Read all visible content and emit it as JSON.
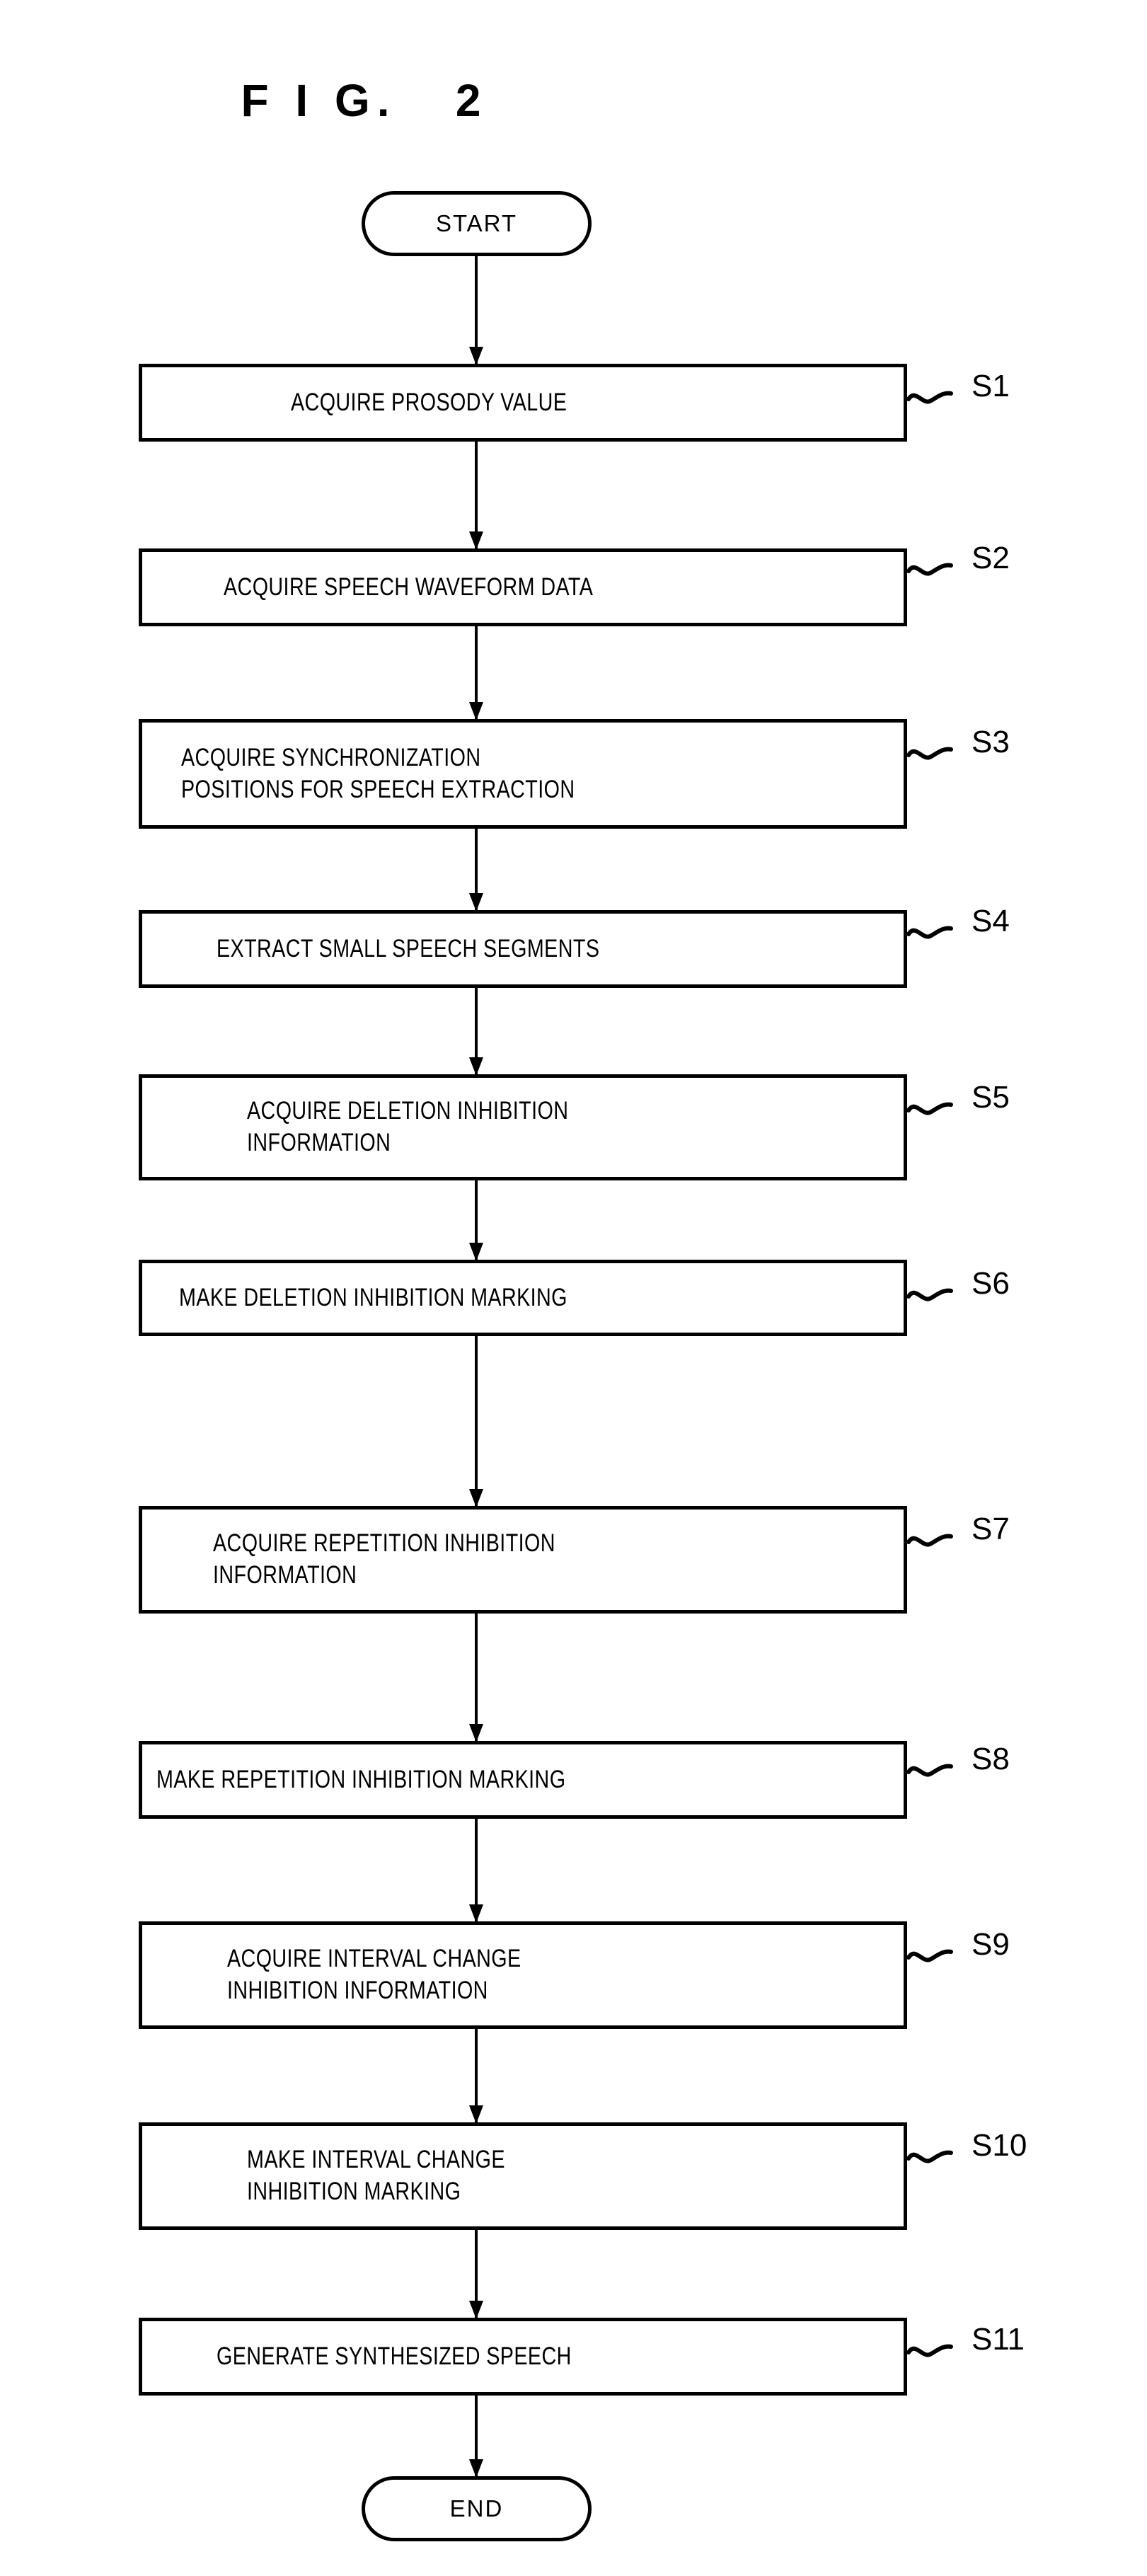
{
  "figure": {
    "title": "F I G.   2"
  },
  "flow": {
    "start_label": "START",
    "end_label": "END",
    "steps": [
      {
        "id": "S1",
        "label": "S1",
        "lines": [
          "ACQUIRE PROSODY VALUE"
        ]
      },
      {
        "id": "S2",
        "label": "S2",
        "lines": [
          "ACQUIRE SPEECH WAVEFORM DATA"
        ]
      },
      {
        "id": "S3",
        "label": "S3",
        "lines": [
          "ACQUIRE SYNCHRONIZATION",
          "POSITIONS FOR SPEECH EXTRACTION"
        ]
      },
      {
        "id": "S4",
        "label": "S4",
        "lines": [
          "EXTRACT SMALL SPEECH SEGMENTS"
        ]
      },
      {
        "id": "S5",
        "label": "S5",
        "lines": [
          "ACQUIRE DELETION INHIBITION",
          "INFORMATION"
        ]
      },
      {
        "id": "S6",
        "label": "S6",
        "lines": [
          "MAKE DELETION INHIBITION MARKING"
        ]
      },
      {
        "id": "S7",
        "label": "S7",
        "lines": [
          "ACQUIRE REPETITION INHIBITION",
          "INFORMATION"
        ]
      },
      {
        "id": "S8",
        "label": "S8",
        "lines": [
          "MAKE REPETITION INHIBITION MARKING"
        ]
      },
      {
        "id": "S9",
        "label": "S9",
        "lines": [
          "ACQUIRE INTERVAL CHANGE",
          "INHIBITION INFORMATION"
        ]
      },
      {
        "id": "S10",
        "label": "S10",
        "lines": [
          "MAKE INTERVAL CHANGE",
          "INHIBITION MARKING"
        ]
      },
      {
        "id": "S11",
        "label": "S11",
        "lines": [
          "GENERATE SYNTHESIZED SPEECH"
        ]
      }
    ]
  },
  "colors": {
    "ink": "#000000",
    "paper": "#ffffff"
  }
}
